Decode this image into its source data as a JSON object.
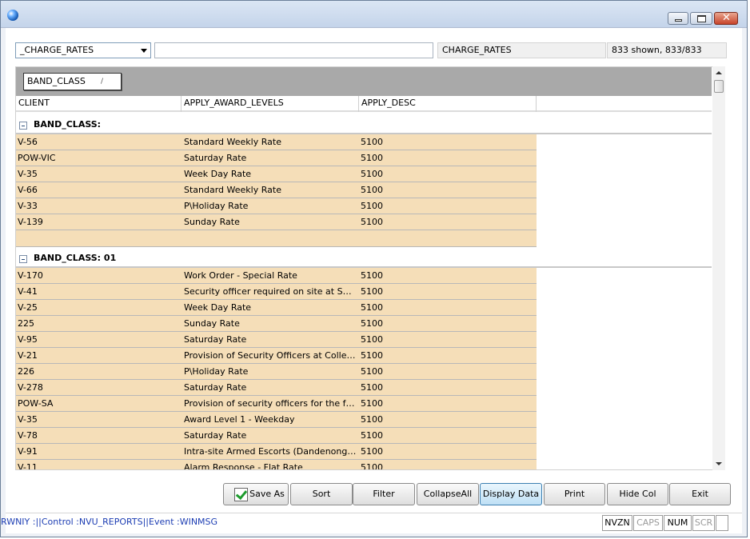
{
  "toolbar": {
    "report_select": "_CHARGE_RATES",
    "search_value": "",
    "table_name": "CHARGE_RATES",
    "record_count": "833 shown, 833/833"
  },
  "grid": {
    "group_by": "BAND_CLASS",
    "group_sort_glyph": "/",
    "columns": [
      "CLIENT",
      "APPLY_AWARD_LEVELS",
      "APPLY_DESC"
    ],
    "groups": [
      {
        "label": "BAND_CLASS:",
        "rows": [
          [
            "V-56",
            "Standard Weekly Rate",
            "5100"
          ],
          [
            "POW-VIC",
            "Saturday Rate",
            "5100"
          ],
          [
            "V-35",
            "Week Day Rate",
            "5100"
          ],
          [
            "V-66",
            "Standard Weekly Rate",
            "5100"
          ],
          [
            "V-33",
            "P\\Holiday Rate",
            "5100"
          ],
          [
            "V-139",
            "Sunday Rate",
            "5100"
          ]
        ]
      },
      {
        "label": "BAND_CLASS: 01",
        "rows": [
          [
            "V-170",
            "Work Order - Special Rate",
            "5100"
          ],
          [
            "V-41",
            "Security officer required on site at SX b...",
            "5100"
          ],
          [
            "V-25",
            "Week Day Rate",
            "5100"
          ],
          [
            "225",
            "Sunday Rate",
            "5100"
          ],
          [
            "V-95",
            "Saturday Rate",
            "5100"
          ],
          [
            "V-21",
            "Provision of Security Officers at College...",
            "5100"
          ],
          [
            "226",
            "P\\Holiday Rate",
            "5100"
          ],
          [
            "V-278",
            "Saturday Rate",
            "5100"
          ],
          [
            "POW-SA",
            "Provision of security officers for the for...",
            "5100"
          ],
          [
            "V-35",
            "Award Level 1 - Weekday",
            "5100"
          ],
          [
            "V-78",
            "Saturday Rate",
            "5100"
          ],
          [
            "V-91",
            "Intra-site Armed Escorts (Dandenong t...",
            "5100"
          ],
          [
            "V-11",
            "Alarm Response - Flat Rate",
            "5100"
          ]
        ]
      }
    ]
  },
  "buttons": {
    "save_as": "Save As",
    "sort": "Sort",
    "filter": "Filter",
    "collapse_all": "CollapseAll",
    "display_data": "Display Data",
    "print": "Print",
    "hide_col": "Hide Col",
    "exit": "Exit"
  },
  "status": {
    "message": "RWNIY :||Control :NVU_REPORTS||Event  :WINMSG",
    "indicators": [
      {
        "label": "NVZN",
        "active": true
      },
      {
        "label": "CAPS",
        "active": false
      },
      {
        "label": "NUM",
        "active": true
      },
      {
        "label": "SCR",
        "active": false
      }
    ]
  },
  "icons": {
    "app": "app-globe-icon",
    "save_as": "checkbox-check-icon"
  },
  "colors": {
    "row_bg": "#f5deb8",
    "group_bar": "#a9a9a9",
    "status_text": "#1c3db3"
  }
}
